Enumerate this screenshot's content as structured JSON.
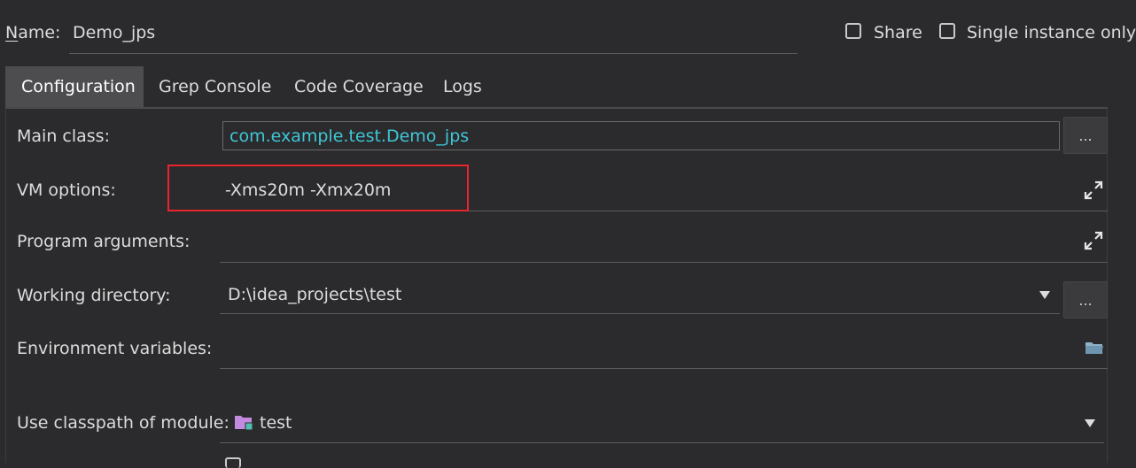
{
  "header": {
    "name_label": "Name:",
    "name_value": "Demo_jps",
    "share_label": "Share",
    "single_instance_label": "Single instance only"
  },
  "tabs": [
    {
      "label": "Configuration",
      "active": true
    },
    {
      "label": "Grep Console",
      "active": false
    },
    {
      "label": "Code Coverage",
      "active": false
    },
    {
      "label": "Logs",
      "active": false
    }
  ],
  "form": {
    "main_class_label": "Main class:",
    "main_class_value": "com.example.test.Demo_jps",
    "vm_options_label": "VM options:",
    "vm_options_value": "-Xms20m -Xmx20m",
    "program_arguments_label": "Program arguments:",
    "program_arguments_value": "",
    "working_directory_label": "Working directory:",
    "working_directory_value": "D:\\idea_projects\\test",
    "environment_variables_label": "Environment variables:",
    "environment_variables_value": "",
    "classpath_module_label": "Use classpath of module:",
    "classpath_module_value": "test",
    "browse_button_label": "...",
    "icons": {
      "expand": "expand-icon",
      "folder": "folder-icon",
      "module": "module-folder-icon",
      "dropdown": "chevron-down-icon"
    }
  },
  "colors": {
    "background": "#2b2b2d",
    "active_tab": "#4d4d50",
    "main_class_text": "#3fc6d6",
    "highlight_box": "#e8252c",
    "module_icon": "#c48ae0"
  }
}
